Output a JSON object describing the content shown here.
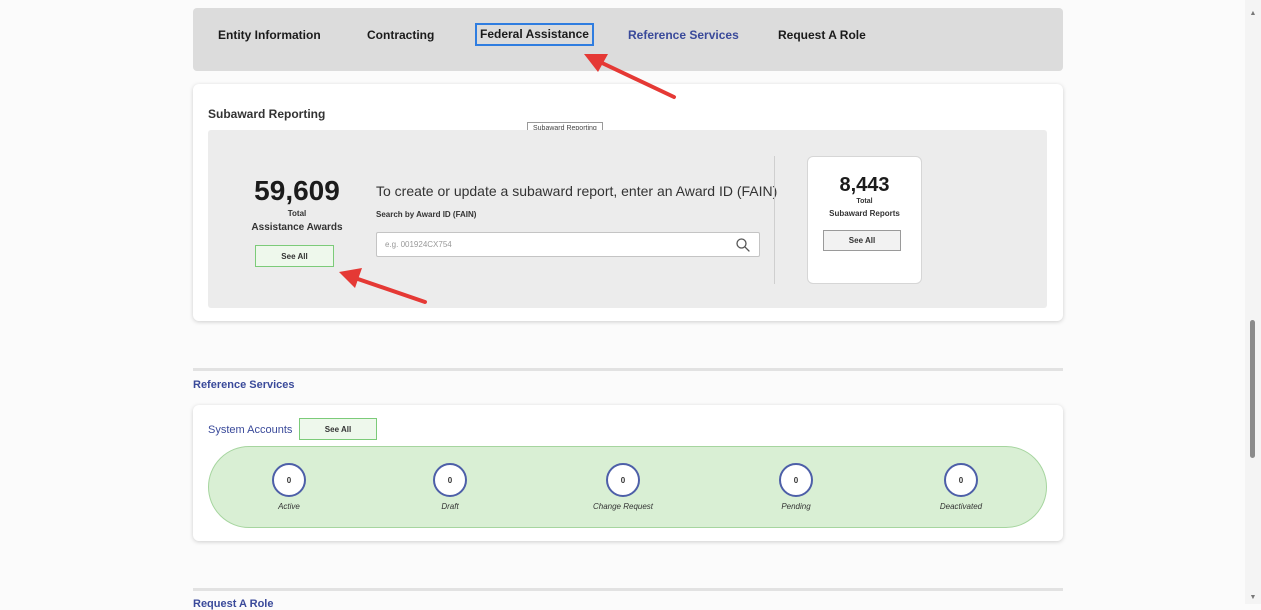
{
  "tabs": [
    {
      "label": "Entity Information"
    },
    {
      "label": "Contracting"
    },
    {
      "label": "Federal Assistance"
    },
    {
      "label": "Reference Services"
    },
    {
      "label": "Request A Role"
    }
  ],
  "subaward": {
    "title": "Subaward Reporting",
    "tooltip": "Subaward Reporting",
    "awards_count": "59,609",
    "awards_total_label": "Total",
    "awards_label": "Assistance Awards",
    "awards_see_all": "See All",
    "prompt": "To create or update a subaward report, enter an Award ID (FAIN)",
    "search_label": "Search by Award ID (FAIN)",
    "search_placeholder": "e.g. 001924CX754",
    "search_icon": "search-icon",
    "reports_count": "8,443",
    "reports_total_label": "Total",
    "reports_label": "Subaward Reports",
    "reports_see_all": "See All"
  },
  "reference_services": {
    "heading": "Reference Services",
    "system_accounts_label": "System Accounts",
    "see_all": "See All",
    "statuses": [
      {
        "count": "0",
        "label": "Active"
      },
      {
        "count": "0",
        "label": "Draft"
      },
      {
        "count": "0",
        "label": "Change Request"
      },
      {
        "count": "0",
        "label": "Pending"
      },
      {
        "count": "0",
        "label": "Deactivated"
      }
    ]
  },
  "request_role": {
    "heading": "Request A Role"
  },
  "colors": {
    "link": "#3a4a9a",
    "focus_outline": "#2f7de0",
    "green_panel": "#d9efd4",
    "green_border": "#7ccb79",
    "annotation_arrow": "#e53935"
  }
}
